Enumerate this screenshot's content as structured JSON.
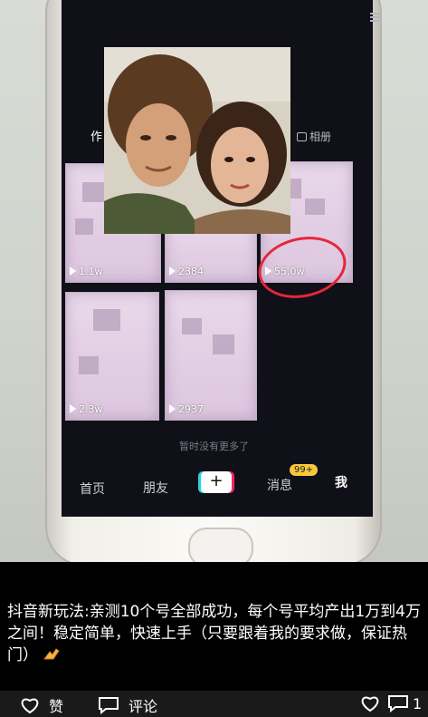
{
  "phone_screen": {
    "tab_works": "作",
    "tab_album": "相册",
    "tiles": [
      {
        "views": "1.1w"
      },
      {
        "views": "2384"
      },
      {
        "views": "55.0w"
      },
      {
        "views": "2.3w"
      },
      {
        "views": "2937"
      }
    ],
    "no_more_text": "暂时没有更多了",
    "nav": {
      "home": "首页",
      "friends": "朋友",
      "plus": "+",
      "messages": "消息",
      "me": "我",
      "badge": "99+"
    },
    "highlight_color": "#e6263a"
  },
  "caption": {
    "text": "抖音新玩法:亲测10个号全部成功，每个号平均产出1万到4万之间！稳定简单，快速上手（只要跟着我的要求做，保证热门）"
  },
  "actions": {
    "like_label": "赞",
    "comment_label": "评论",
    "comment_count": "1"
  }
}
